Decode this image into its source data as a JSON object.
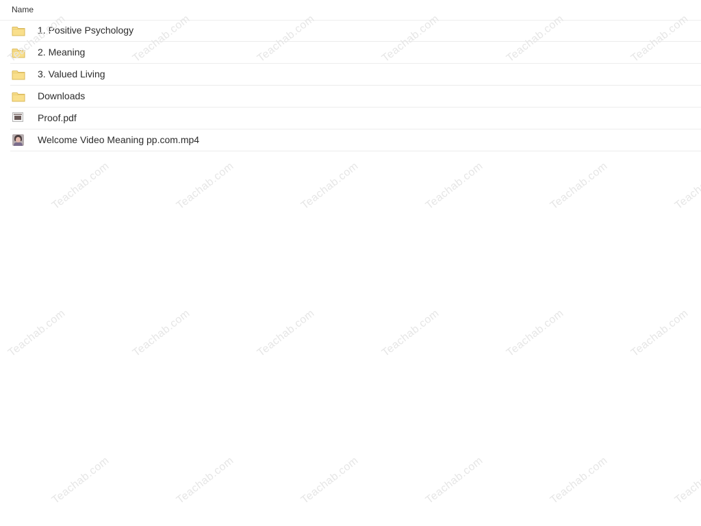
{
  "header": {
    "name_label": "Name"
  },
  "files": [
    {
      "name": "1. Positive Psychology",
      "type": "folder",
      "icon": "folder-icon"
    },
    {
      "name": "2. Meaning",
      "type": "folder",
      "icon": "folder-icon"
    },
    {
      "name": "3. Valued Living",
      "type": "folder",
      "icon": "folder-icon"
    },
    {
      "name": "Downloads",
      "type": "folder",
      "icon": "folder-icon"
    },
    {
      "name": "Proof.pdf",
      "type": "pdf",
      "icon": "pdf-thumbnail-icon"
    },
    {
      "name": "Welcome Video Meaning pp.com.mp4",
      "type": "video",
      "icon": "video-thumbnail-icon"
    }
  ],
  "watermark": {
    "text": "Teachab.com"
  },
  "colors": {
    "folder_fill": "#f9df8c",
    "folder_stroke": "#d9b85a",
    "row_divider": "#ececec",
    "watermark": "#e6e6e6"
  }
}
